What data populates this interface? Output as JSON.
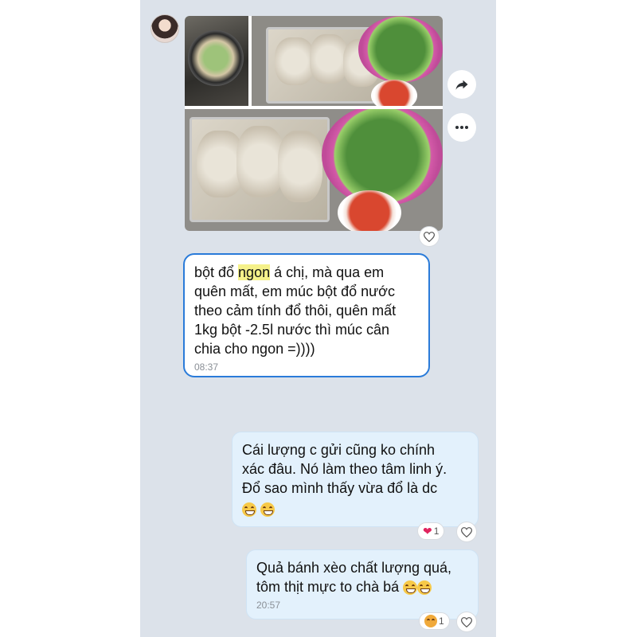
{
  "chat": {
    "avatar_icon": "profile-avatar-icon",
    "media_message": {
      "photo_count": 3,
      "icons": {
        "forward": "share-forward-icon",
        "more": "more-dots-icon",
        "react": "heart-outline-icon"
      }
    },
    "messages": [
      {
        "direction": "incoming",
        "text_before_highlight": "bột đổ ",
        "highlight": "ngon",
        "text_after_highlight": " á chị, mà qua em\nquên mất, em múc bột đổ nước\ntheo cảm tính đổ thôi, quên mất\n1kg bột -2.5l nước thì múc cân\nchia cho ngon =))))",
        "time": "08:37",
        "selected_border_color": "#2a7bd9"
      },
      {
        "direction": "outgoing",
        "text": "Cái lượng c gửi cũng ko chính\nxác đâu. Nó làm theo tâm linh ý.\nĐổ sao mình thấy vừa đổ là dc",
        "emojis": [
          "grinning-face-icon",
          "grinning-face-icon"
        ],
        "reaction": {
          "icon": "red-heart-icon",
          "count": "1"
        },
        "react_icon": "heart-outline-icon"
      },
      {
        "direction": "outgoing",
        "text": "Quả bánh xèo chất lượng quá,\ntôm thịt mực to chà bá",
        "emojis": [
          "grinning-face-icon",
          "grinning-face-icon"
        ],
        "time": "20:57",
        "reaction": {
          "icon": "face-emoji-icon",
          "count": "1"
        },
        "react_icon": "heart-outline-icon"
      }
    ]
  },
  "colors": {
    "chat_background": "#dce2ea",
    "outgoing_bubble": "#e3f1fc",
    "highlight": "#f5f18a"
  }
}
